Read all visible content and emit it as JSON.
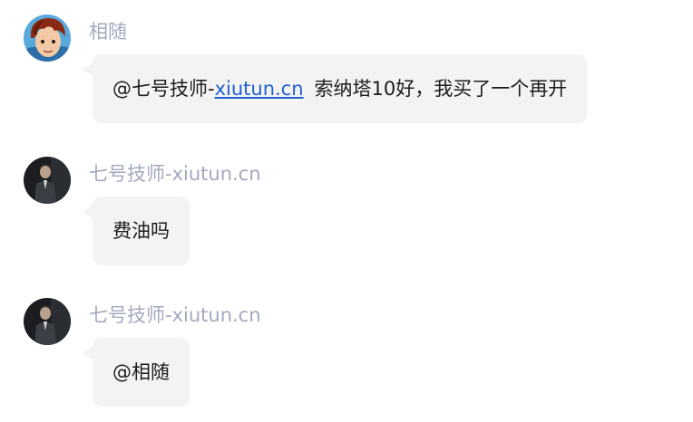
{
  "messages": [
    {
      "sender": "相随",
      "avatar_icon": "cartoon-boy-avatar-icon",
      "mention": "@七号技师-",
      "link": "xiutun.cn",
      "text": "索纳塔10好，我买了一个再开"
    },
    {
      "sender": "七号技师-xiutun.cn",
      "avatar_icon": "man-in-suit-avatar-icon",
      "text": "费油吗"
    },
    {
      "sender": "七号技师-xiutun.cn",
      "avatar_icon": "man-in-suit-avatar-icon",
      "text": "@相随"
    }
  ],
  "colors": {
    "sender_name": "#a2a9bd",
    "bubble_background": "#f3f3f4",
    "link": "#1f5fd1",
    "text": "#1c1c1c"
  }
}
